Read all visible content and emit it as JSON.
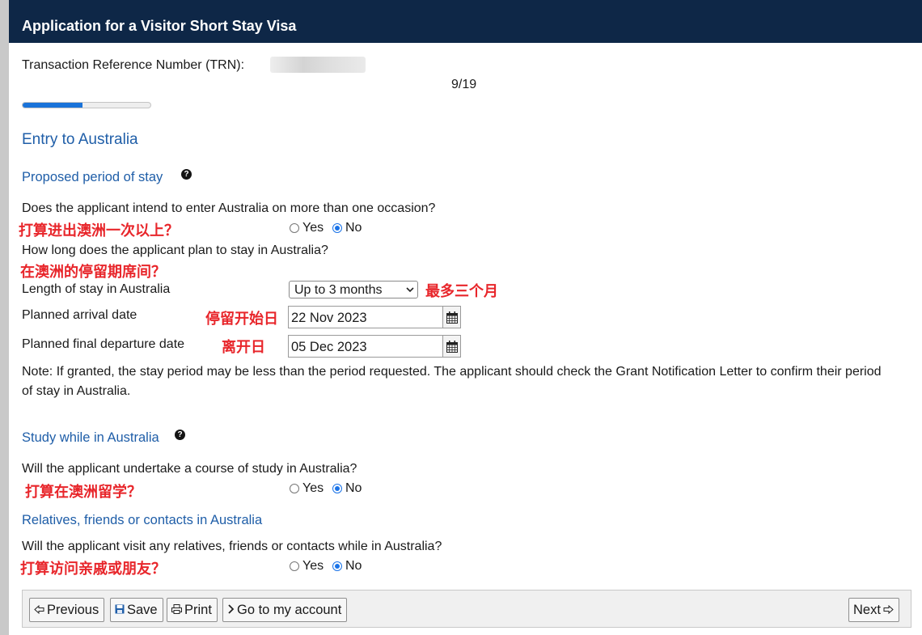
{
  "header": {
    "title": "Application for a Visitor Short Stay Visa"
  },
  "trn": {
    "label": "Transaction Reference Number (TRN):"
  },
  "progress": {
    "text": "9/19",
    "current": 9,
    "total": 19,
    "fraction": 0.47
  },
  "sections": {
    "entry_title": "Entry to Australia",
    "period_title": "Proposed period of stay",
    "study_title": "Study while in Australia",
    "relatives_title": "Relatives, friends or contacts in Australia"
  },
  "questions": {
    "more_than_once": {
      "text": "Does the applicant intend to enter Australia on more than one occasion?",
      "annotation": "打算进出澳洲一次以上？",
      "options": [
        "Yes",
        "No"
      ],
      "selected": "No"
    },
    "how_long": {
      "text": "How long does the applicant plan to stay in Australia?",
      "annotation": "在澳洲的停留期席间？"
    },
    "study": {
      "text": "Will the applicant undertake a course of study in Australia?",
      "annotation": "打算在澳洲留学？",
      "options": [
        "Yes",
        "No"
      ],
      "selected": "No"
    },
    "relatives": {
      "text": "Will the applicant visit any relatives, friends or contacts while in Australia?",
      "annotation": "打算访问亲戚或朋友？",
      "options": [
        "Yes",
        "No"
      ],
      "selected": "No"
    }
  },
  "fields": {
    "length": {
      "label": "Length of stay in Australia",
      "value": "Up to 3 months",
      "annotation": "最多三个月"
    },
    "arrival": {
      "label": "Planned arrival date",
      "value": "22 Nov 2023",
      "annotation": "停留开始日"
    },
    "departure": {
      "label": "Planned final departure date",
      "value": "05 Dec 2023",
      "annotation": "离开日"
    }
  },
  "note": "Note: If granted, the stay period may be less than the period requested. The applicant should check the Grant Notification Letter to confirm their period of stay in Australia.",
  "footer": {
    "previous": "Previous",
    "save": "Save",
    "print": "Print",
    "account": "Go to my account",
    "next": "Next"
  },
  "colors": {
    "header_bg": "#0e2747",
    "heading": "#1f5ea8",
    "annotation": "#e8262b",
    "progress": "#1a73d9"
  }
}
